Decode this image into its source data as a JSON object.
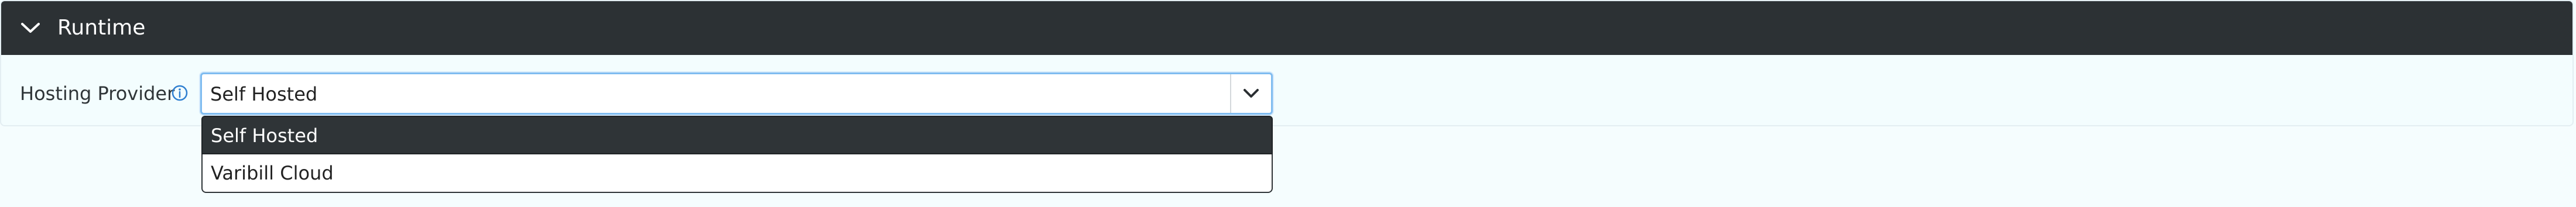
{
  "section": {
    "title": "Runtime"
  },
  "hosting_provider": {
    "label": "Hosting Provider",
    "selected_value": "Self Hosted",
    "options": [
      "Self Hosted",
      "Varibill Cloud"
    ]
  },
  "colors": {
    "header_bg": "#2c3134",
    "page_bg": "#f5fdfe",
    "focus_border": "#7fbcf0",
    "selected_option_bg": "#2f3437",
    "info_icon": "#2f7fd0"
  },
  "icons": {
    "section_toggle": "chevron-down-icon",
    "field_info": "info-circle-icon",
    "select_toggle": "chevron-down-icon"
  }
}
